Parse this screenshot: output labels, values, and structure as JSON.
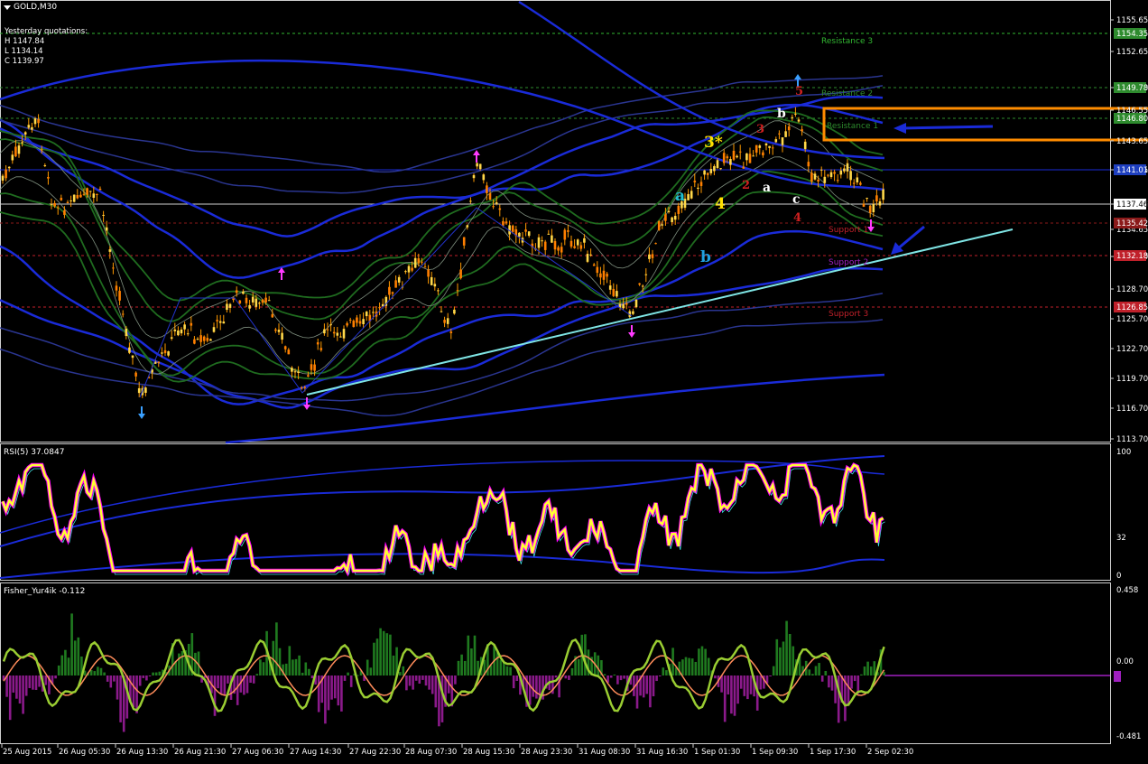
{
  "symbol": "GOLD,M30",
  "yesterday": {
    "title": "Yesterday quotations:",
    "high": "H 1147.84",
    "low": "L 1134.14",
    "close": "C 1139.97"
  },
  "price_axis": [
    "1155.65",
    "1152.65",
    "1149.50",
    "1146.55",
    "1143.65",
    "1140.55",
    "1137.46",
    "1134.65",
    "1131.60",
    "1128.70",
    "1125.70",
    "1122.70",
    "1119.70",
    "1116.70",
    "1113.70"
  ],
  "price_badges": [
    {
      "text": "1154.35",
      "color": "#2e8b2e"
    },
    {
      "text": "1149.78",
      "color": "#2e8b2e"
    },
    {
      "text": "1146.80",
      "color": "#2e8b2e"
    },
    {
      "text": "1141.01",
      "color": "#1e3fbf"
    },
    {
      "text": "1137.46",
      "color": "#ffffff"
    },
    {
      "text": "1135.42",
      "color": "#8b1a1a"
    },
    {
      "text": "1132.18",
      "color": "#c0202a"
    },
    {
      "text": "1126.85",
      "color": "#c0202a"
    }
  ],
  "levels": {
    "r3": "Resistance 3",
    "r2": "Resistance 2",
    "r1": "Resistance 1",
    "s1": "Support 1",
    "s2": "Support 2",
    "s3": "Support 3"
  },
  "wave_labels": {
    "w3star": "3*",
    "w4": "4",
    "wa1": "a",
    "wb1": "b",
    "w2": "2",
    "w3": "3",
    "wa2": "a",
    "wb2": "b",
    "wc2": "c",
    "w4r": "4",
    "w5": "5"
  },
  "rsi": {
    "title": "RSI(5) 37.0847",
    "axis": [
      "100",
      "32",
      "0"
    ]
  },
  "fisher": {
    "title": "Fisher_Yur4ik -0.112",
    "axis": [
      "0.458",
      "0.00",
      "0.00",
      "-0.481"
    ]
  },
  "time_axis": [
    "25 Aug 2015",
    "26 Aug 05:30",
    "26 Aug 13:30",
    "26 Aug 21:30",
    "27 Aug 06:30",
    "27 Aug 14:30",
    "27 Aug 22:30",
    "28 Aug 07:30",
    "28 Aug 15:30",
    "28 Aug 23:30",
    "31 Aug 08:30",
    "31 Aug 16:30",
    "1 Sep 01:30",
    "1 Sep 09:30",
    "1 Sep 17:30",
    "2 Sep 02:30"
  ],
  "colors": {
    "bull": "#ffb000",
    "bear": "#ff8c00",
    "band_blue": "#1a2bd8",
    "band_green": "#1f6b1f",
    "trend": "#7fe5e5",
    "rsi": "#ffff33",
    "rsi_shadow": "#ff00ff",
    "fisher_line": "#9acd32",
    "fisher_signal": "#ff8c5a",
    "hist_pos": "#1f7a1f",
    "hist_neg": "#8b1a8b",
    "box": "#ff8c00"
  }
}
